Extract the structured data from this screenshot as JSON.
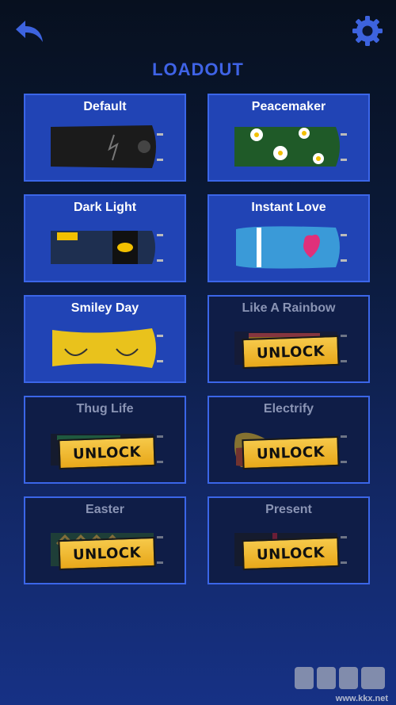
{
  "header": {
    "back_icon": "back-arrow-icon",
    "settings_icon": "gear-icon",
    "title": "LOADOUT"
  },
  "accent_color": "#3b66e8",
  "unlock_color": "#f2bd3a",
  "loadout": [
    {
      "name": "Default",
      "locked": false,
      "design": "default"
    },
    {
      "name": "Peacemaker",
      "locked": false,
      "design": "peacemaker"
    },
    {
      "name": "Dark Light",
      "locked": false,
      "design": "darklight"
    },
    {
      "name": "Instant Love",
      "locked": false,
      "design": "instantlove"
    },
    {
      "name": "Smiley Day",
      "locked": false,
      "design": "smiley"
    },
    {
      "name": "Like A Rainbow",
      "locked": true,
      "design": "rainbow",
      "action": "UNLOCK"
    },
    {
      "name": "Thug Life",
      "locked": true,
      "design": "thug",
      "action": "UNLOCK"
    },
    {
      "name": "Electrify",
      "locked": true,
      "design": "electrify",
      "action": "UNLOCK"
    },
    {
      "name": "Easter",
      "locked": true,
      "design": "easter",
      "action": "UNLOCK"
    },
    {
      "name": "Present",
      "locked": true,
      "design": "present",
      "action": "UNLOCK"
    }
  ],
  "watermark": {
    "logo": "KKX",
    "url": "www.kkx.net"
  }
}
